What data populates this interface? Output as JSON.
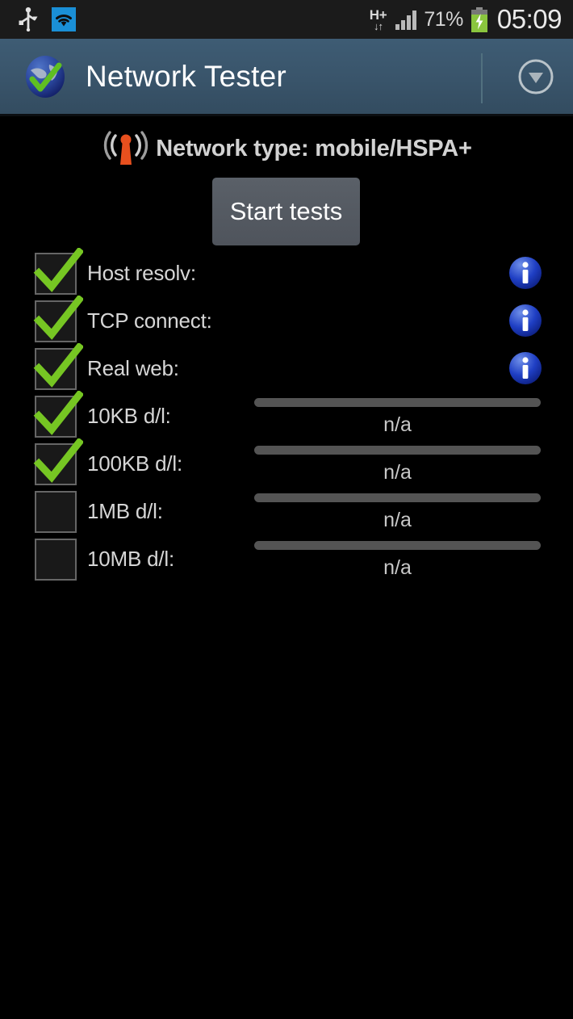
{
  "status_bar": {
    "usb_icon": "usb-icon",
    "wifi_icon": "wifi-icon",
    "network_type_label": "H+",
    "network_arrows": "↓↑",
    "signal_icon": "signal-bars-icon",
    "battery_percent": "71%",
    "battery_icon": "battery-charging-icon",
    "clock": "05:09"
  },
  "title_bar": {
    "app_icon": "globe-check-icon",
    "title": "Network Tester",
    "dropdown_icon": "chevron-down-circle-icon"
  },
  "network_info": {
    "antenna_icon": "antenna-broadcast-icon",
    "text": "Network type: mobile/HSPA+"
  },
  "actions": {
    "start_tests_label": "Start tests"
  },
  "tests": [
    {
      "label": "Host resolv:",
      "checked": true,
      "has_info": true,
      "has_progress": false,
      "progress": 0,
      "result": ""
    },
    {
      "label": "TCP connect:",
      "checked": true,
      "has_info": true,
      "has_progress": false,
      "progress": 0,
      "result": ""
    },
    {
      "label": "Real web:",
      "checked": true,
      "has_info": true,
      "has_progress": false,
      "progress": 0,
      "result": ""
    },
    {
      "label": "10KB d/l:",
      "checked": true,
      "has_info": false,
      "has_progress": true,
      "progress": 0,
      "result": "n/a"
    },
    {
      "label": "100KB d/l:",
      "checked": true,
      "has_info": false,
      "has_progress": true,
      "progress": 0,
      "result": "n/a"
    },
    {
      "label": "1MB d/l:",
      "checked": false,
      "has_info": false,
      "has_progress": true,
      "progress": 0,
      "result": "n/a"
    },
    {
      "label": "10MB d/l:",
      "checked": false,
      "has_info": false,
      "has_progress": true,
      "progress": 0,
      "result": "n/a"
    }
  ],
  "colors": {
    "background": "#000000",
    "status_bar": "#1b1b1b",
    "title_bar": "#39546a",
    "check_green": "#76c623",
    "info_blue": "#1f3fc4",
    "antenna_orange": "#e8501e",
    "progress_track": "#545454",
    "button_gray": "#545a62",
    "wifi_blue": "#1a8fd6",
    "battery_green": "#8ac53e"
  }
}
